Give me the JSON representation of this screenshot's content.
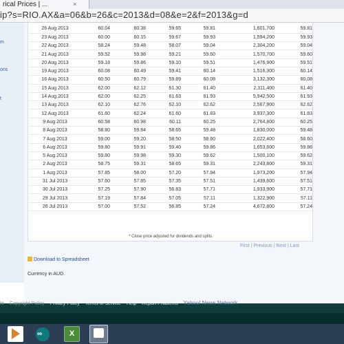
{
  "browser": {
    "tab_title": "rical Prices | ...",
    "tab_close": "×",
    "url": "ip?s=RIO.AX&a=06&b=26&c=2013&d=08&e=2&f=2013&g=d"
  },
  "sidebar": {
    "items": [
      "m",
      "ons",
      "t"
    ]
  },
  "table": {
    "rows": [
      [
        "26 Aug 2013",
        "60.04",
        "60.38",
        "59.65",
        "59.81",
        "1,601,700",
        "59.81"
      ],
      [
        "23 Aug 2013",
        "60.00",
        "60.15",
        "59.67",
        "59.93",
        "1,594,200",
        "59.93"
      ],
      [
        "22 Aug 2013",
        "58.24",
        "59.48",
        "58.07",
        "59.04",
        "2,304,200",
        "59.04"
      ],
      [
        "21 Aug 2013",
        "59.52",
        "59.98",
        "59.21",
        "59.60",
        "1,570,700",
        "59.60"
      ],
      [
        "20 Aug 2013",
        "59.18",
        "59.86",
        "59.10",
        "59.51",
        "1,476,900",
        "59.51"
      ],
      [
        "19 Aug 2013",
        "60.08",
        "60.49",
        "59.41",
        "60.14",
        "1,516,300",
        "60.14"
      ],
      [
        "16 Aug 2013",
        "60.50",
        "60.79",
        "59.89",
        "60.08",
        "3,132,300",
        "60.08"
      ],
      [
        "15 Aug 2013",
        "62.00",
        "62.12",
        "61.30",
        "61.40",
        "2,311,400",
        "61.40"
      ],
      [
        "14 Aug 2013",
        "62.00",
        "62.25",
        "61.63",
        "61.93",
        "5,942,500",
        "61.93"
      ],
      [
        "13 Aug 2013",
        "62.10",
        "62.76",
        "62.10",
        "62.62",
        "2,567,900",
        "62.62"
      ],
      [
        "12 Aug 2013",
        "61.60",
        "62.24",
        "61.60",
        "61.83",
        "3,937,300",
        "61.83"
      ],
      [
        "9 Aug 2013",
        "60.58",
        "60.98",
        "60.11",
        "60.25",
        "2,764,800",
        "60.25"
      ],
      [
        "8 Aug 2013",
        "58.80",
        "59.84",
        "58.65",
        "59.48",
        "1,830,000",
        "59.48"
      ],
      [
        "7 Aug 2013",
        "59.00",
        "59.20",
        "58.50",
        "58.60",
        "2,022,400",
        "58.60"
      ],
      [
        "6 Aug 2013",
        "59.80",
        "59.91",
        "59.40",
        "59.86",
        "1,653,600",
        "59.86"
      ],
      [
        "5 Aug 2013",
        "59.80",
        "59.98",
        "59.30",
        "59.62",
        "1,500,100",
        "59.62"
      ],
      [
        "2 Aug 2013",
        "58.75",
        "59.31",
        "58.65",
        "59.31",
        "2,243,800",
        "59.31"
      ],
      [
        "1 Aug 2013",
        "57.85",
        "58.00",
        "57.20",
        "57.94",
        "1,973,200",
        "57.94"
      ],
      [
        "31 Jul 2013",
        "57.60",
        "57.85",
        "57.35",
        "57.51",
        "1,439,600",
        "57.51"
      ],
      [
        "30 Jul 2013",
        "57.25",
        "57.90",
        "56.83",
        "57.71",
        "1,933,900",
        "57.71"
      ],
      [
        "29 Jul 2013",
        "57.19",
        "57.84",
        "57.05",
        "57.11",
        "1,322,900",
        "57.11"
      ],
      [
        "26 Jul 2013",
        "57.00",
        "57.52",
        "56.85",
        "57.24",
        "4,672,800",
        "57.24"
      ]
    ],
    "footnote": "* Close price adjusted for dividends and splits."
  },
  "pager": {
    "first": "First",
    "previous": "Previous",
    "next": "Next",
    "last": "Last",
    "separator": "|"
  },
  "download_label": "Download to Spreadsheet",
  "currency_label": "Currency in AUD.",
  "footer": {
    "links": [
      "Copyright Policy",
      "Privacy Policy",
      "Terms of Service",
      "Help",
      "Report Problems"
    ],
    "network": "Yahoo! News Network",
    "leading_fragment": "ht"
  },
  "taskbar": {
    "apps": [
      "media-player-icon",
      "arduino-icon",
      "excel-icon",
      "window-icon"
    ],
    "excel_glyph": "X"
  },
  "colors": {
    "link": "#1a4fa0",
    "footer_bg": "#0f3d3d",
    "taskbar_bg": "#2c3e55",
    "sidebar_bg": "#e8eef5"
  }
}
